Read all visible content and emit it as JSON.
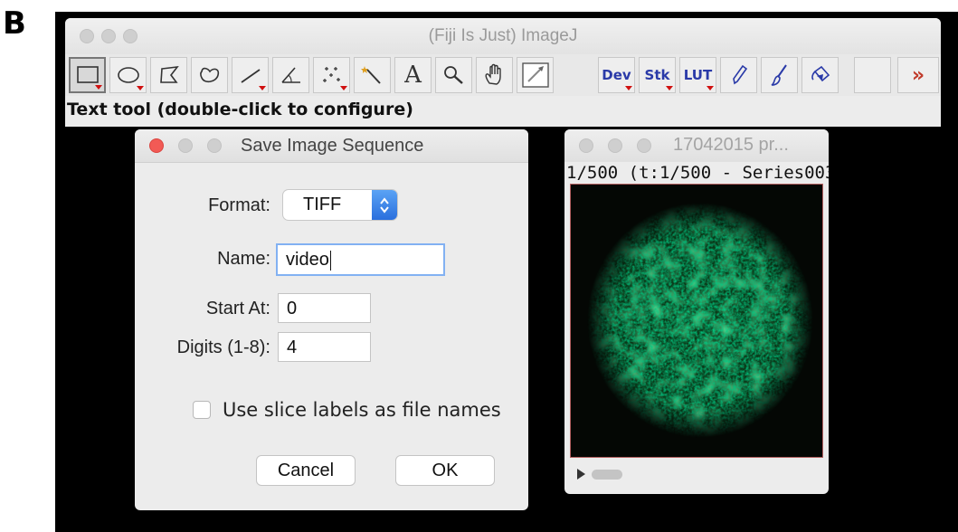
{
  "panel_label": "B",
  "main_window": {
    "title": "(Fiji Is Just) ImageJ",
    "tools": [
      {
        "name": "rectangle-tool",
        "icon": "rectangle-icon",
        "selected": true,
        "has_menu": true
      },
      {
        "name": "oval-tool",
        "icon": "oval-icon",
        "has_menu": true
      },
      {
        "name": "polygon-tool",
        "icon": "polygon-icon"
      },
      {
        "name": "freehand-tool",
        "icon": "freehand-icon"
      },
      {
        "name": "line-tool",
        "icon": "line-icon",
        "has_menu": true
      },
      {
        "name": "angle-tool",
        "icon": "angle-icon"
      },
      {
        "name": "multipoint-tool",
        "icon": "multipoint-icon",
        "has_menu": true
      },
      {
        "name": "wand-tool",
        "icon": "wand-icon"
      },
      {
        "name": "text-tool",
        "icon": "text-icon",
        "text": "A"
      },
      {
        "name": "magnifier-tool",
        "icon": "magnifier-icon"
      },
      {
        "name": "hand-tool",
        "icon": "hand-icon"
      },
      {
        "name": "color-picker-tool",
        "icon": "dropper-icon"
      },
      {
        "name": "dev-menu-tool",
        "icon": "dev-menu-icon",
        "text": "Dev",
        "has_menu": true
      },
      {
        "name": "stk-menu-tool",
        "icon": "stk-menu-icon",
        "text": "Stk",
        "has_menu": true
      },
      {
        "name": "lut-menu-tool",
        "icon": "lut-menu-icon",
        "text": "LUT",
        "has_menu": true
      },
      {
        "name": "pencil-tool",
        "icon": "pencil-icon"
      },
      {
        "name": "brush-tool",
        "icon": "brush-icon"
      },
      {
        "name": "flood-fill-tool",
        "icon": "bucket-icon"
      },
      {
        "name": "empty-tool-slot",
        "icon": "blank"
      },
      {
        "name": "more-tools",
        "icon": "double-chevron-right-icon"
      }
    ],
    "status": "Text tool (double-click to configure)"
  },
  "dialog": {
    "title": "Save Image Sequence",
    "format_label": "Format:",
    "format_value": "TIFF",
    "name_label": "Name:",
    "name_value": "video",
    "start_label": "Start At:",
    "start_value": "0",
    "digits_label": "Digits (1-8):",
    "digits_value": "4",
    "checkbox_label": "Use slice labels as file names",
    "checkbox_checked": false,
    "cancel_label": "Cancel",
    "ok_label": "OK"
  },
  "image_window": {
    "title": "17042015 pr...",
    "subtitle": "1/500 (t:1/500 - Series003",
    "image_color": "#1f9a3e"
  }
}
